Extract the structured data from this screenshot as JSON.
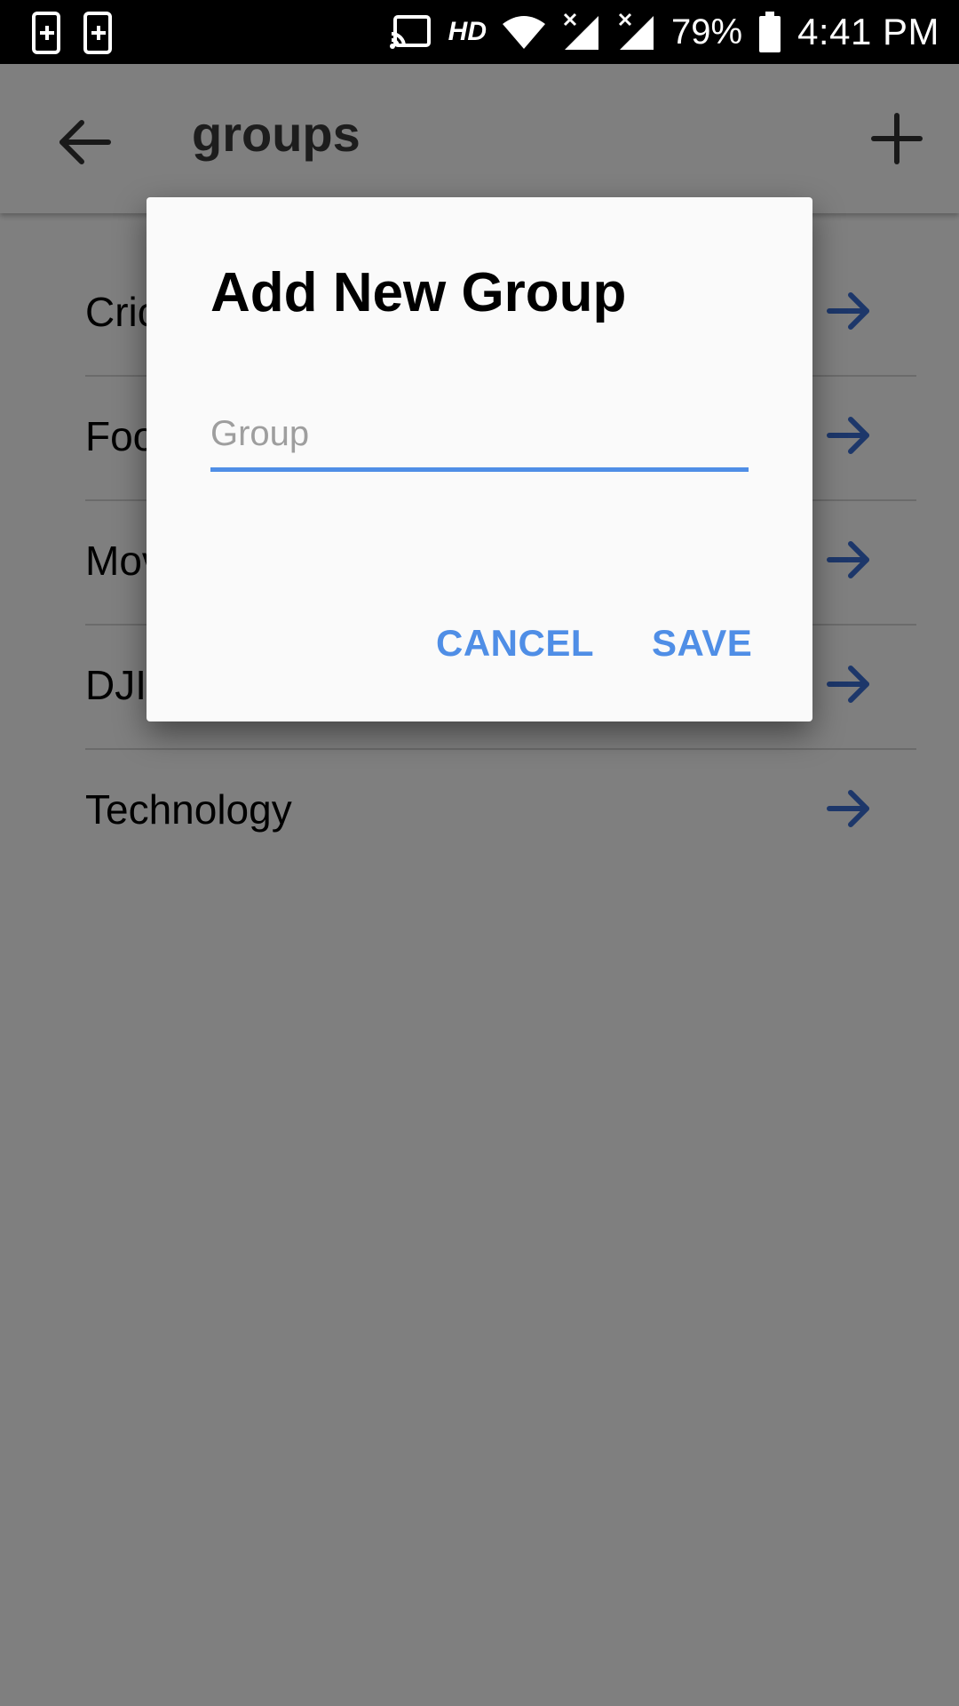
{
  "status_bar": {
    "hd_label": "HD",
    "battery_percent": "79%",
    "time": "4:41 PM",
    "icons": [
      "phone-add-icon",
      "phone-add-icon",
      "cast-icon",
      "wifi-icon",
      "signal-icon",
      "signal-icon",
      "battery-icon"
    ]
  },
  "app_bar": {
    "title": "groups",
    "back_icon": "arrow-left-icon",
    "add_icon": "plus-icon"
  },
  "groups": [
    {
      "label": "Cricket"
    },
    {
      "label": "Food"
    },
    {
      "label": "Movies"
    },
    {
      "label": "DJI"
    },
    {
      "label": "Technology"
    }
  ],
  "dialog": {
    "title": "Add New Group",
    "input_placeholder": "Group",
    "input_value": "",
    "cancel_label": "CANCEL",
    "save_label": "SAVE"
  },
  "colors": {
    "accent": "#4f8ee6",
    "list_arrow": "#3b6fd4",
    "scrim": "rgba(0,0,0,0.5)"
  }
}
